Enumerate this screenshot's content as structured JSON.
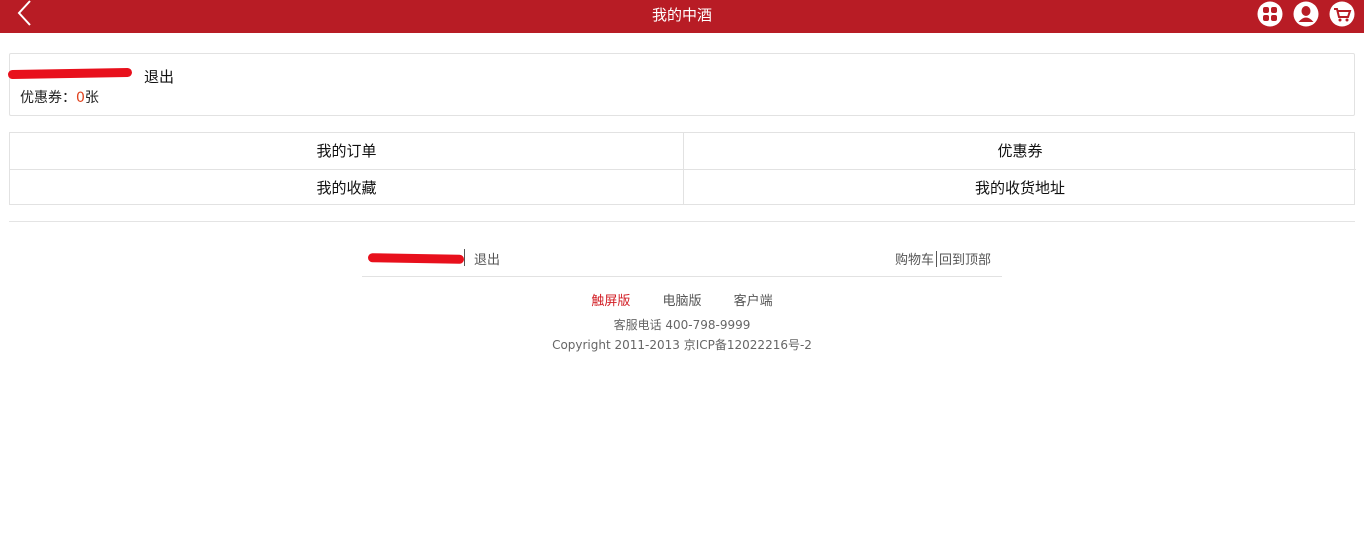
{
  "header": {
    "title": "我的中酒",
    "icons": [
      "chevron-left-icon",
      "apps-icon",
      "user-icon",
      "cart-icon"
    ],
    "accent_color": "#b81c25"
  },
  "user_card": {
    "logout_label": "退出",
    "coupon_label": "优惠券：",
    "coupon_count": "0",
    "coupon_unit": "张"
  },
  "menu": {
    "items": [
      {
        "label": "我的订单"
      },
      {
        "label": "优惠券"
      },
      {
        "label": "我的收藏"
      },
      {
        "label": "我的收货地址"
      }
    ]
  },
  "footer": {
    "logout_label": "退出",
    "cart_label": "购物车",
    "top_label": "回到顶部",
    "versions": [
      {
        "label": "触屏版",
        "active": true
      },
      {
        "label": "电脑版",
        "active": false
      },
      {
        "label": "客户端",
        "active": false
      }
    ],
    "hotline": "客服电话 400-798-9999",
    "copyright": "Copyright 2011-2013 京ICP备12022216号-2"
  }
}
